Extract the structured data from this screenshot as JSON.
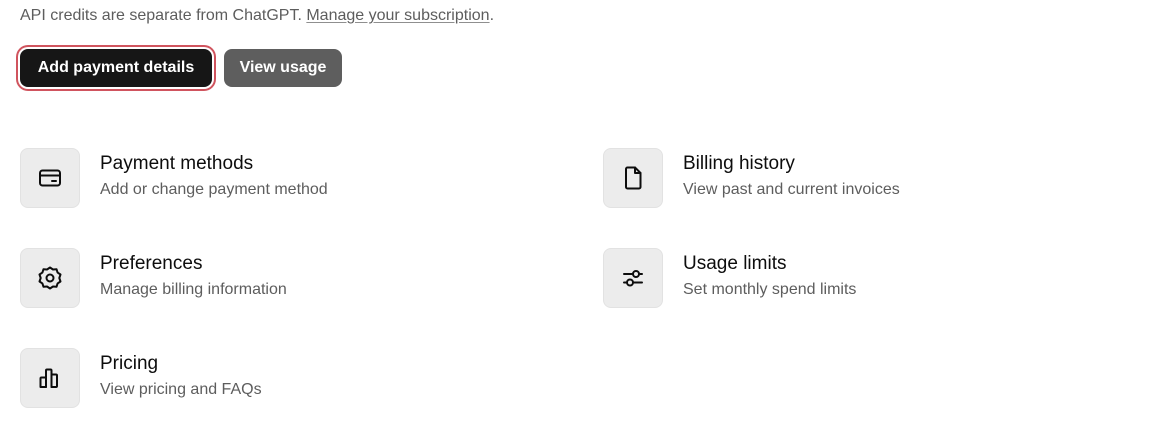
{
  "intro": {
    "text": "API credits are separate from ChatGPT. ",
    "link_label": "Manage your subscription",
    "suffix": "."
  },
  "actions": {
    "add_payment_label": "Add payment details",
    "view_usage_label": "View usage"
  },
  "cards": [
    {
      "title": "Payment methods",
      "description": "Add or change payment method",
      "icon": "credit-card-icon"
    },
    {
      "title": "Billing history",
      "description": "View past and current invoices",
      "icon": "document-icon"
    },
    {
      "title": "Preferences",
      "description": "Manage billing information",
      "icon": "gear-icon"
    },
    {
      "title": "Usage limits",
      "description": "Set monthly spend limits",
      "icon": "sliders-icon"
    },
    {
      "title": "Pricing",
      "description": "View pricing and FAQs",
      "icon": "bar-chart-icon"
    }
  ],
  "colors": {
    "primary_button": "#161616",
    "secondary_button": "#5e5e5e",
    "focus_ring": "#d0545e",
    "icon_tile": "#ececec"
  }
}
